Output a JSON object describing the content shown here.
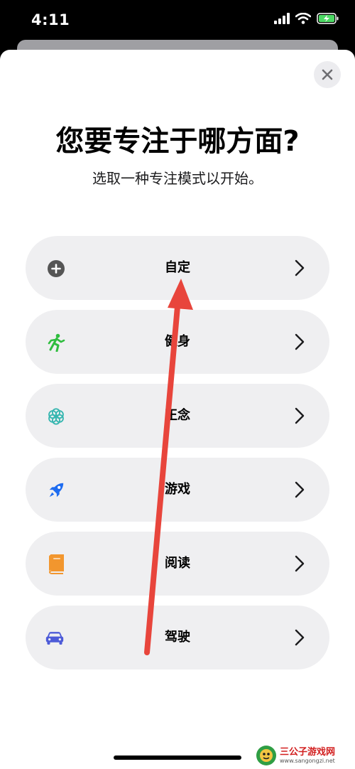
{
  "status_bar": {
    "time": "4:11"
  },
  "sheet": {
    "title": "您要专注于哪方面?",
    "subtitle": "选取一种专注模式以开始。",
    "close_icon": "xmark-icon"
  },
  "options": [
    {
      "label": "自定",
      "icon": "plus-circle-icon",
      "color": "#555555"
    },
    {
      "label": "健身",
      "icon": "running-figure-icon",
      "color": "#2fbd3f"
    },
    {
      "label": "正念",
      "icon": "flower-icon",
      "color": "#36b6b0"
    },
    {
      "label": "游戏",
      "icon": "rocket-icon",
      "color": "#1e6cf0"
    },
    {
      "label": "阅读",
      "icon": "book-icon",
      "color": "#f2962e"
    },
    {
      "label": "驾驶",
      "icon": "car-icon",
      "color": "#4d5bd8"
    }
  ],
  "annotation": {
    "arrow_color": "#e8453c"
  },
  "watermark": {
    "text": "三公子游戏网",
    "url": "www.sangongzi.net"
  }
}
